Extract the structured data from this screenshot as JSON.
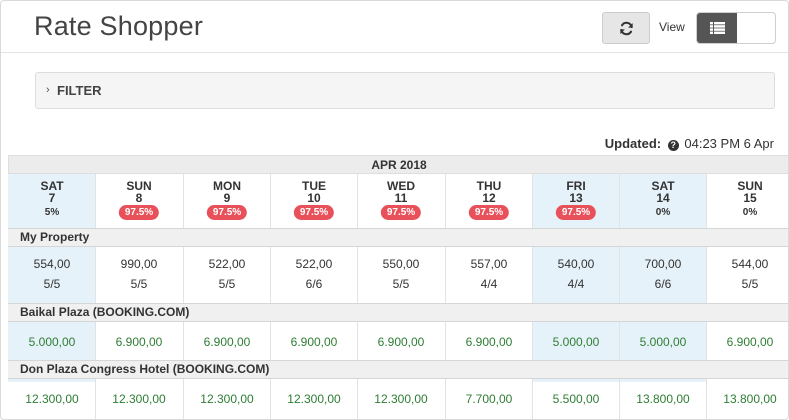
{
  "header": {
    "title": "Rate Shopper",
    "view_label": "View",
    "refresh_icon": "refresh-icon",
    "list_view_icon": "list-icon"
  },
  "filter": {
    "label": "FILTER"
  },
  "updated": {
    "label": "Updated:",
    "time": "04:23 PM 6 Apr"
  },
  "calendar": {
    "month": "APR 2018",
    "days": [
      {
        "dow": "SAT",
        "day": "7",
        "occupancy": "5%",
        "alert": false,
        "highlight": true
      },
      {
        "dow": "SUN",
        "day": "8",
        "occupancy": "97.5%",
        "alert": true,
        "highlight": false
      },
      {
        "dow": "MON",
        "day": "9",
        "occupancy": "97.5%",
        "alert": true,
        "highlight": false
      },
      {
        "dow": "TUE",
        "day": "10",
        "occupancy": "97.5%",
        "alert": true,
        "highlight": false
      },
      {
        "dow": "WED",
        "day": "11",
        "occupancy": "97.5%",
        "alert": true,
        "highlight": false
      },
      {
        "dow": "THU",
        "day": "12",
        "occupancy": "97.5%",
        "alert": true,
        "highlight": false
      },
      {
        "dow": "FRI",
        "day": "13",
        "occupancy": "97.5%",
        "alert": true,
        "highlight": true
      },
      {
        "dow": "SAT",
        "day": "14",
        "occupancy": "0%",
        "alert": false,
        "highlight": true
      },
      {
        "dow": "SUN",
        "day": "15",
        "occupancy": "0%",
        "alert": false,
        "highlight": false
      }
    ]
  },
  "properties": [
    {
      "name": "My Property",
      "rates": [
        "554,00",
        "990,00",
        "522,00",
        "522,00",
        "550,00",
        "557,00",
        "540,00",
        "700,00",
        "544,00"
      ],
      "availability": [
        "5/5",
        "5/5",
        "5/5",
        "6/6",
        "5/5",
        "4/4",
        "4/4",
        "6/6",
        "5/5"
      ]
    },
    {
      "name": "Baikal Plaza (BOOKING.COM)",
      "rates": [
        "5.000,00",
        "6.900,00",
        "6.900,00",
        "6.900,00",
        "6.900,00",
        "6.900,00",
        "5.000,00",
        "5.000,00",
        "6.900,00"
      ]
    },
    {
      "name": "Don Plaza Congress Hotel (BOOKING.COM)",
      "rates": [
        "12.300,00",
        "12.300,00",
        "12.300,00",
        "12.300,00",
        "12.300,00",
        "7.700,00",
        "5.500,00",
        "13.800,00",
        "13.800,00"
      ]
    }
  ],
  "colors": {
    "alert_pill": "#e8515a",
    "competitor_rate": "#2f7d34",
    "highlight_column": "#e6f2f9"
  }
}
